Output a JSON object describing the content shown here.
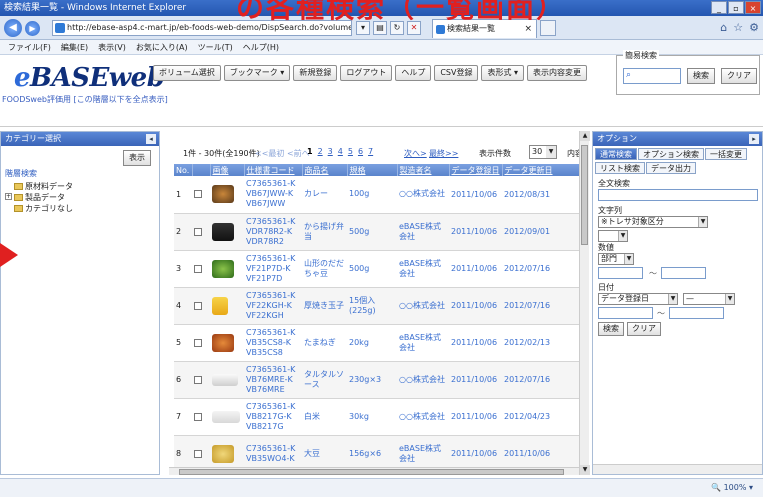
{
  "overlay": {
    "title": "の各種検索（一覧画面）"
  },
  "window": {
    "title": "検索結果一覧 - Windows Internet Explorer",
    "minimize": "_",
    "maximize": "▫",
    "close": "×"
  },
  "address": {
    "url": "http://ebase-asp4.c-mart.jp/eb-foods-web-demo/DispSearch.do?volumeName=00",
    "tab_label": "検索結果一覧",
    "tab_close": "×"
  },
  "menu": [
    "ファイル(F)",
    "編集(E)",
    "表示(V)",
    "お気に入り(A)",
    "ツール(T)",
    "ヘルプ(H)"
  ],
  "header": {
    "logo_e": "e",
    "logo_rest": "BASEweb",
    "subtitle": "FOODSweb評価用 [この階層以下を全点表示]",
    "toolbar": [
      "ボリューム選択",
      "ブックマーク ▾",
      "新規登録",
      "ログアウト",
      "ヘルプ",
      "CSV登録",
      "表形式 ▾",
      "表示内容変更"
    ],
    "quick_search": {
      "legend": "簡易検索",
      "search_btn": "検索",
      "clear_btn": "クリア"
    }
  },
  "category_panel": {
    "title": "カテゴリー選択",
    "collapse": "◂",
    "show_btn": "表示",
    "root": "階層検索",
    "nodes": [
      "原材料データ",
      "製品データ",
      "カテゴリなし"
    ],
    "plus": "+"
  },
  "list": {
    "count": "1件 - 30件(全190件)",
    "prev": "<<最初  <前へ",
    "pages": [
      "1",
      "2",
      "3",
      "4",
      "5",
      "6",
      "7"
    ],
    "next": "次へ>",
    "last": "最終>>",
    "page_size_label": "表示件数",
    "page_size": "30",
    "content_label": "内容",
    "columns": [
      "No.",
      "",
      "画像",
      "仕様書コード",
      "商品名",
      "規格",
      "製造者名",
      "データ登録日",
      "データ更新日"
    ],
    "rows": [
      {
        "no": "1",
        "code": "C7365361-K VB67JWW-K VB67JWW",
        "name": "カレー",
        "spec": "100g",
        "maker": "○○株式会社",
        "created": "2011/10/06",
        "updated": "2012/08/31"
      },
      {
        "no": "2",
        "code": "C7365361-K VDR78R2-K VDR78R2",
        "name": "から揚げ弁当",
        "spec": "500g",
        "maker": "eBASE株式会社",
        "created": "2011/10/06",
        "updated": "2012/09/01"
      },
      {
        "no": "3",
        "code": "C7365361-K VF21P7D-K VF21P7D",
        "name": "山形のだだちゃ豆",
        "spec": "500g",
        "maker": "eBASE株式会社",
        "created": "2011/10/06",
        "updated": "2012/07/16"
      },
      {
        "no": "4",
        "code": "C7365361-K VF22KGH-K VF22KGH",
        "name": "厚焼き玉子",
        "spec": "15個入(225g)",
        "maker": "○○株式会社",
        "created": "2011/10/06",
        "updated": "2012/07/16"
      },
      {
        "no": "5",
        "code": "C7365361-K VB35CS8-K VB35CS8",
        "name": "たまねぎ",
        "spec": "20kg",
        "maker": "eBASE株式会社",
        "created": "2011/10/06",
        "updated": "2012/02/13"
      },
      {
        "no": "6",
        "code": "C7365361-K VB76MRE-K VB76MRE",
        "name": "タルタルソース",
        "spec": "230g×3",
        "maker": "○○株式会社",
        "created": "2011/10/06",
        "updated": "2012/07/16"
      },
      {
        "no": "7",
        "code": "C7365361-K VB8217G-K VB8217G",
        "name": "白米",
        "spec": "30kg",
        "maker": "○○株式会社",
        "created": "2011/10/06",
        "updated": "2012/04/23"
      },
      {
        "no": "8",
        "code": "C7365361-K VB35WO4-K",
        "name": "大豆",
        "spec": "156g×6",
        "maker": "eBASE株式会社",
        "created": "2011/10/06",
        "updated": "2011/10/06"
      }
    ]
  },
  "options": {
    "title": "オプション",
    "tabs": [
      "通常検索",
      "オプション検索",
      "一括変更"
    ],
    "tabs2": [
      "リスト検索",
      "データ出力"
    ],
    "fulltext_label": "全文検索",
    "string_label": "文字列",
    "string_field": "※トレサ対象区分",
    "number_label": "数値",
    "number_field": "部門",
    "date_label": "日付",
    "date_field": "データ登録日",
    "date_op": "—",
    "tilde": "～",
    "search_btn": "検索",
    "clear_btn": "クリア"
  },
  "status": {
    "zoom": "100%"
  },
  "colors": {
    "accent": "#3a64b8",
    "link": "#2d5cc0",
    "overlay": "#e02020"
  }
}
